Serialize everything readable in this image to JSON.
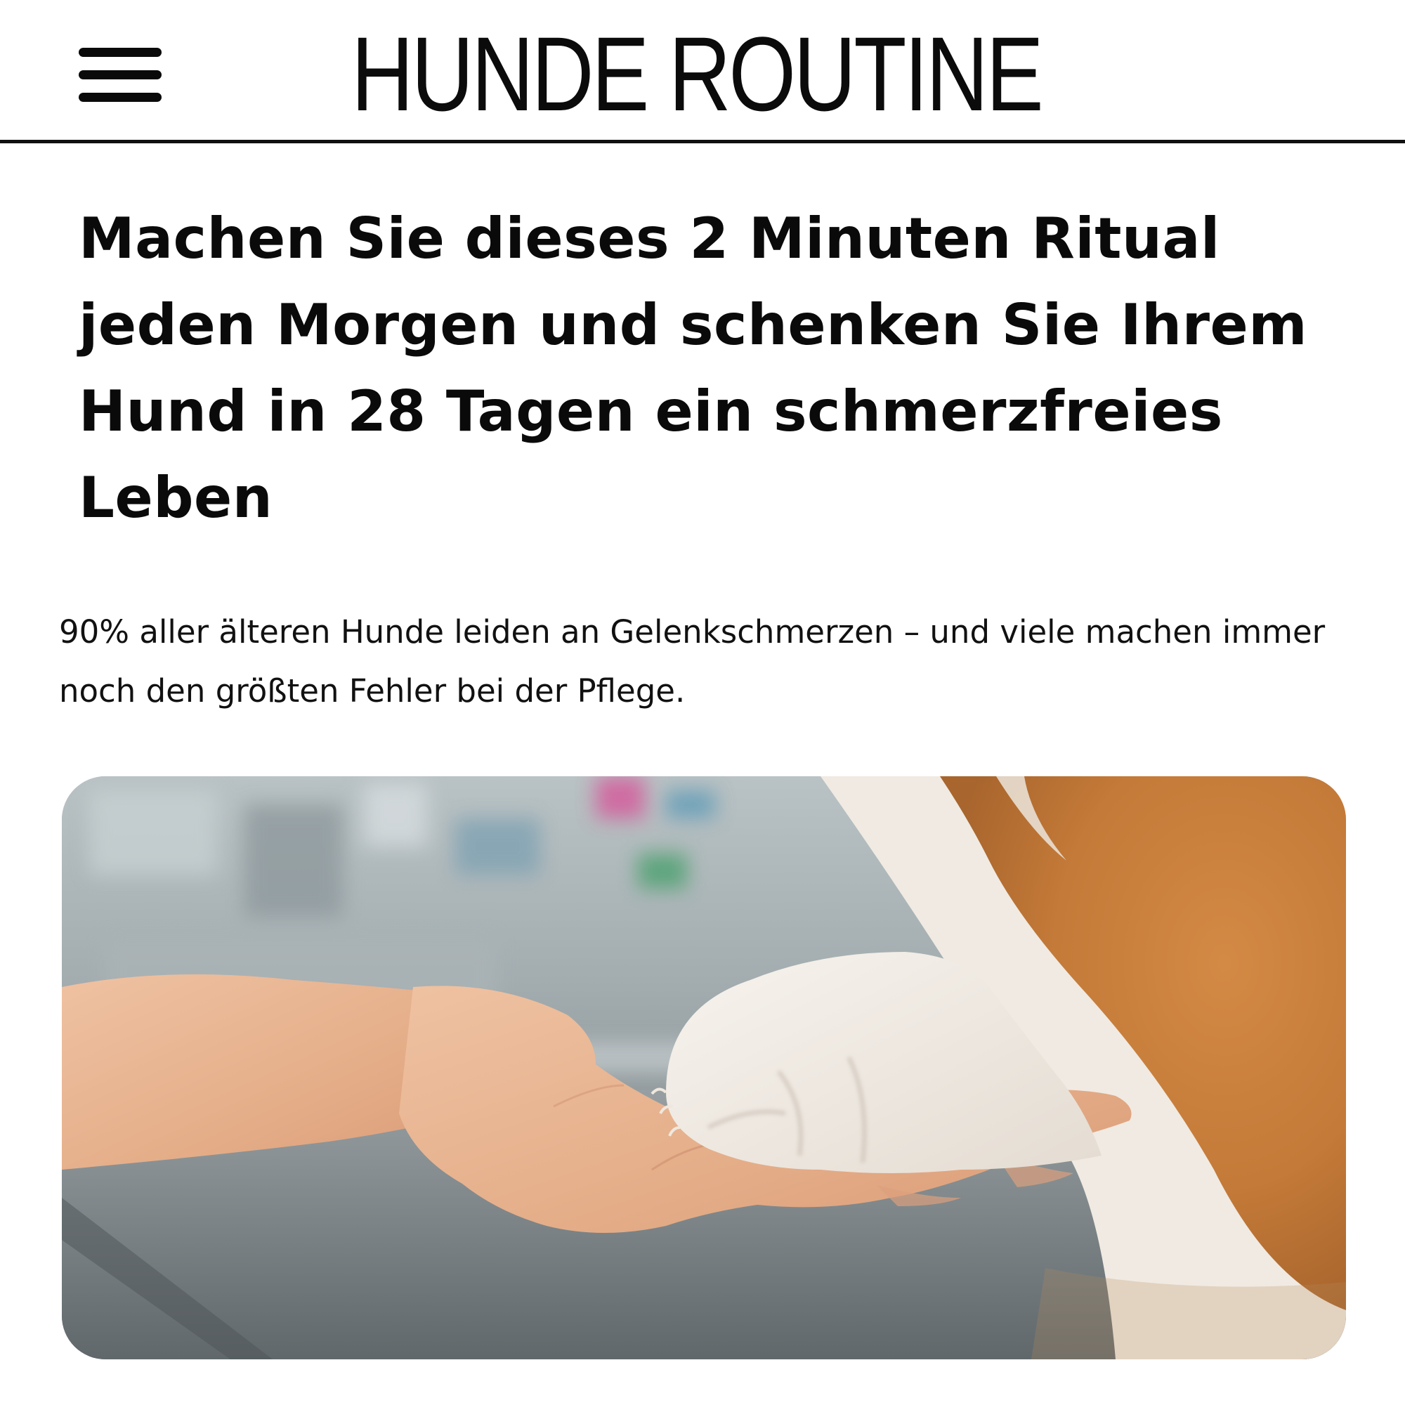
{
  "header": {
    "brand": "HUNDE ROUTINE",
    "menu_icon": "hamburger-menu-icon"
  },
  "article": {
    "headline": "Machen Sie dieses 2 Minuten Ritual jeden Morgen und schenken Sie Ihrem Hund in 28 Tagen ein schmerzfreies Leben",
    "lead": "90% aller älteren Hunde leiden an Gelenkschmerzen – und viele machen immer noch den größten Fehler bei der Pflege."
  },
  "colors": {
    "text": "#0a0a0a",
    "background": "#ffffff",
    "divider": "#111111",
    "fur_orange": "#c9823f",
    "fur_white": "#f2ede6",
    "skin": "#e9b896"
  }
}
